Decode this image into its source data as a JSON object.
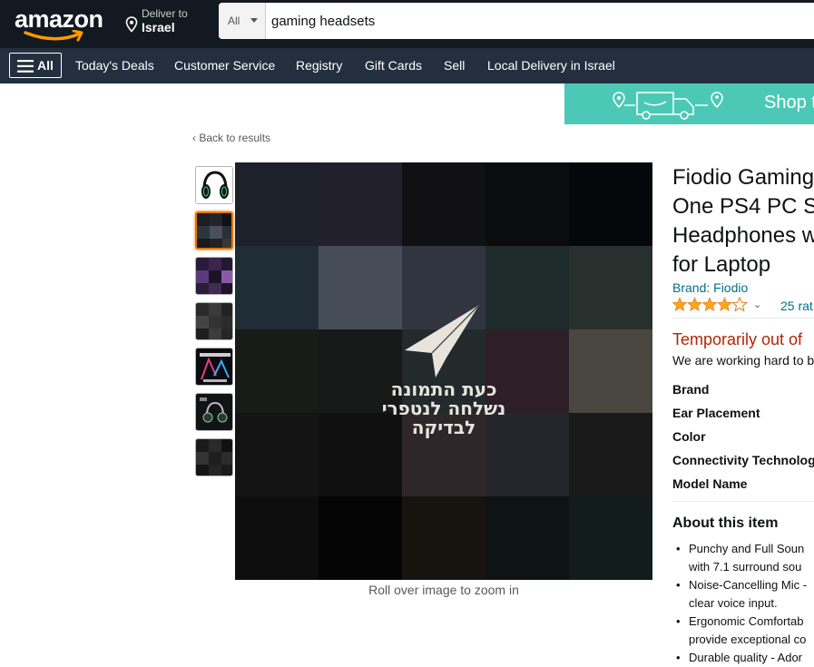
{
  "header": {
    "logo_text": "amazon",
    "deliver_line1": "Deliver to",
    "deliver_line2": "Israel",
    "search_category": "All",
    "search_value": "gaming headsets"
  },
  "nav": {
    "all_label": "All",
    "items": [
      "Today's Deals",
      "Customer Service",
      "Registry",
      "Gift Cards",
      "Sell",
      "Local Delivery in Israel"
    ]
  },
  "banner": {
    "text": "Shop t"
  },
  "back_link": "‹  Back to results",
  "image": {
    "overlay_lines": [
      "כעת התמונה",
      "נשלחה לנטפרי",
      "לבדיקה"
    ],
    "zoom_note": "Roll over image to zoom in"
  },
  "product": {
    "title_lines": [
      "Fiodio Gaming",
      "One PS4 PC Sw",
      "Headphones w",
      "for Laptop"
    ],
    "brand": "Brand: Fiodio",
    "rating_stars": 4,
    "ratings_text": "25 rat",
    "availability": "Temporarily out of",
    "availability_note": "We are working hard to b",
    "specs": [
      "Brand",
      "Ear Placement",
      "Color",
      "Connectivity Technolog",
      "Model Name"
    ],
    "about_title": "About this item",
    "bullets": [
      [
        "Punchy and Full Soun",
        "with 7.1 surround sou"
      ],
      [
        "Noise-Cancelling Mic -",
        "clear voice input."
      ],
      [
        "Ergonomic Comfortab",
        "provide exceptional co"
      ],
      [
        "Durable quality - Ador"
      ]
    ]
  },
  "colors": {
    "header_bg": "#131921",
    "nav_bg": "#232f3e",
    "link": "#007185",
    "unavailable": "#b12704",
    "banner": "#4cc9b6",
    "star": "#ffa41c"
  }
}
